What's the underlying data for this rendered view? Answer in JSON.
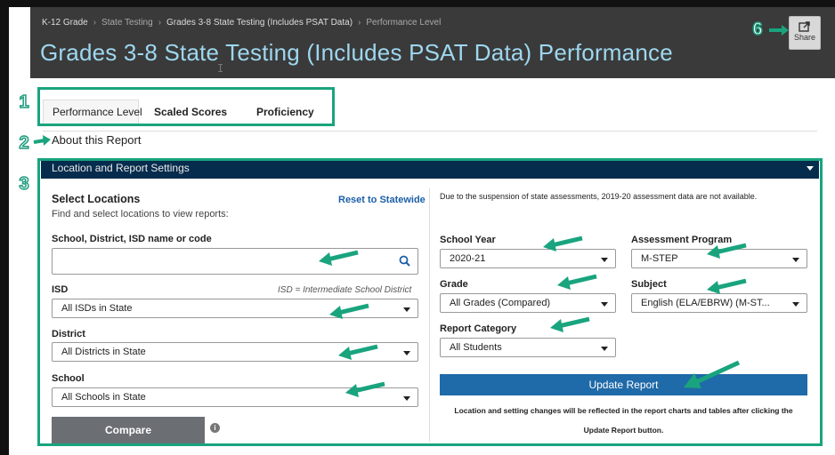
{
  "breadcrumb": {
    "items": [
      "K-12 Grade",
      "State Testing",
      "Grades 3-8 State Testing (Includes PSAT Data)",
      "Performance Level"
    ]
  },
  "page_title": "Grades 3-8 State Testing (Includes PSAT Data) Performance",
  "share": {
    "label": "Share",
    "icon": "share-icon"
  },
  "annotations": [
    "1",
    "2",
    "3",
    "6"
  ],
  "tabs": [
    {
      "label": "Performance Level",
      "active": true
    },
    {
      "label": "Scaled Scores",
      "active": false
    },
    {
      "label": "Proficiency",
      "active": false
    }
  ],
  "about": {
    "label": "About this Report"
  },
  "settings": {
    "title": "Location and Report Settings",
    "select_locations": {
      "title": "Select Locations",
      "subtitle": "Find and select locations to view reports:",
      "reset_label": "Reset to Statewide"
    },
    "search": {
      "label": "School, District, ISD name or code",
      "value": "",
      "placeholder": ""
    },
    "isd": {
      "label": "ISD",
      "note": "ISD = Intermediate School District",
      "value": "All ISDs in State"
    },
    "district": {
      "label": "District",
      "value": "All Districts in State"
    },
    "school": {
      "label": "School",
      "value": "All Schools in State"
    },
    "compare_label": "Compare",
    "notice": "Due to the suspension of state assessments, 2019-20 assessment data are not available.",
    "school_year": {
      "label": "School Year",
      "value": "2020-21"
    },
    "assessment_program": {
      "label": "Assessment Program",
      "value": "M-STEP"
    },
    "grade": {
      "label": "Grade",
      "value": "All Grades (Compared)"
    },
    "subject": {
      "label": "Subject",
      "value": "English (ELA/EBRW) (M-ST..."
    },
    "report_category": {
      "label": "Report Category",
      "value": "All Students"
    },
    "update_label": "Update Report",
    "update_note_line1": "Location and setting changes will be reflected in the report charts and tables after clicking the",
    "update_note_line2": "Update Report button."
  },
  "colors": {
    "annotation": "#19a47e",
    "header_bg": "#3a3a3a",
    "title": "#9ed7ef",
    "settings_head": "#062c4d",
    "update_btn": "#1f6aa8"
  }
}
